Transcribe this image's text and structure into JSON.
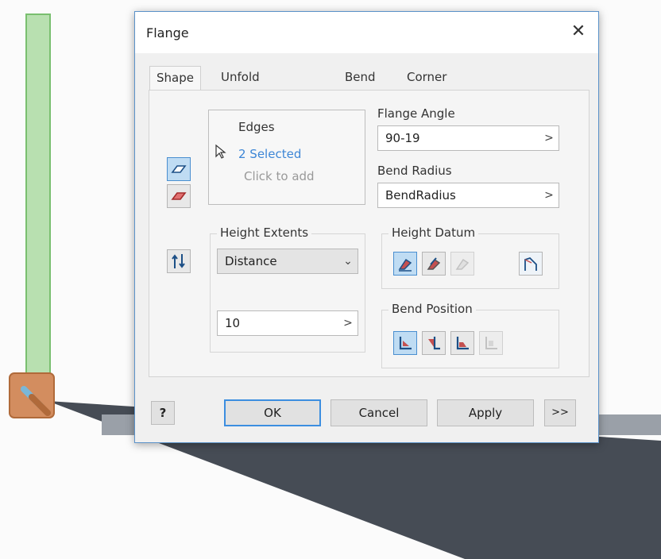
{
  "dialog": {
    "title": "Flange",
    "close_label": "✕",
    "tabs": [
      {
        "label": "Shape",
        "active": true
      },
      {
        "label": "Unfold Options"
      },
      {
        "label": "Bend"
      },
      {
        "label": "Corner"
      }
    ],
    "edges": {
      "label": "Edges",
      "selected_text": "2 Selected",
      "hint": "Click to add"
    },
    "flange_angle": {
      "label": "Flange Angle",
      "value": "90-19",
      "arrow": ">"
    },
    "bend_radius": {
      "label": "Bend Radius",
      "value": "BendRadius",
      "arrow": ">"
    },
    "height_extents": {
      "label": "Height Extents",
      "type_value": "Distance",
      "chevron": "⌄",
      "distance_value": "10",
      "arrow": ">"
    },
    "height_datum": {
      "label": "Height Datum"
    },
    "bend_position": {
      "label": "Bend Position"
    },
    "buttons": {
      "help": "?",
      "ok": "OK",
      "cancel": "Cancel",
      "apply": "Apply",
      "more": ">>"
    }
  },
  "colors": {
    "selected_link": "#3d86d6",
    "accent_border": "#3c8ee0",
    "selected_edge": "#8fcf8f",
    "model_face": "#464c55"
  }
}
